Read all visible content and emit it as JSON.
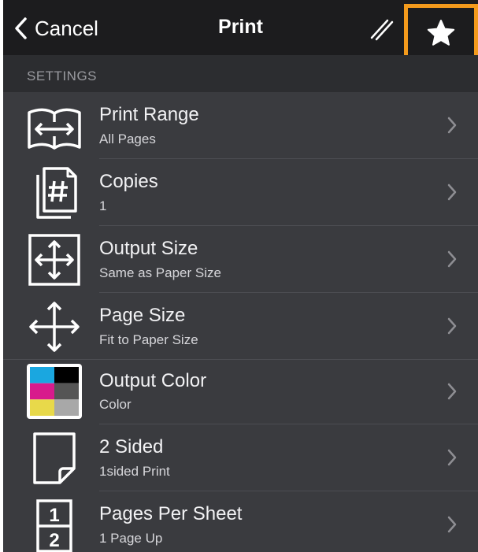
{
  "navbar": {
    "cancel_label": "Cancel",
    "title": "Print",
    "edit_icon": "slash-edit-icon",
    "favorite_icon": "star-icon",
    "highlight_color": "#f39a1c"
  },
  "settings": {
    "header": "SETTINGS",
    "items": [
      {
        "title": "Print Range",
        "subtitle": "All Pages",
        "icon": "print-range-icon"
      },
      {
        "title": "Copies",
        "subtitle": "1",
        "icon": "copies-icon"
      },
      {
        "title": "Output Size",
        "subtitle": "Same as Paper Size",
        "icon": "output-size-icon"
      },
      {
        "title": "Page Size",
        "subtitle": "Fit to Paper Size",
        "icon": "page-size-icon"
      },
      {
        "title": "Output Color",
        "subtitle": "Color",
        "icon": "output-color-icon"
      },
      {
        "title": "2 Sided",
        "subtitle": "1sided Print",
        "icon": "two-sided-icon"
      },
      {
        "title": "Pages Per Sheet",
        "subtitle": "1 Page Up",
        "icon": "pages-per-sheet-icon"
      }
    ]
  },
  "colors": {
    "background": "#3a3b3f",
    "navbar": "#1c1c1e",
    "cmyk": [
      "#1aa7e0",
      "#000000",
      "#d81b8c",
      "#555555",
      "#e8d94a",
      "#a8a8a8"
    ]
  }
}
